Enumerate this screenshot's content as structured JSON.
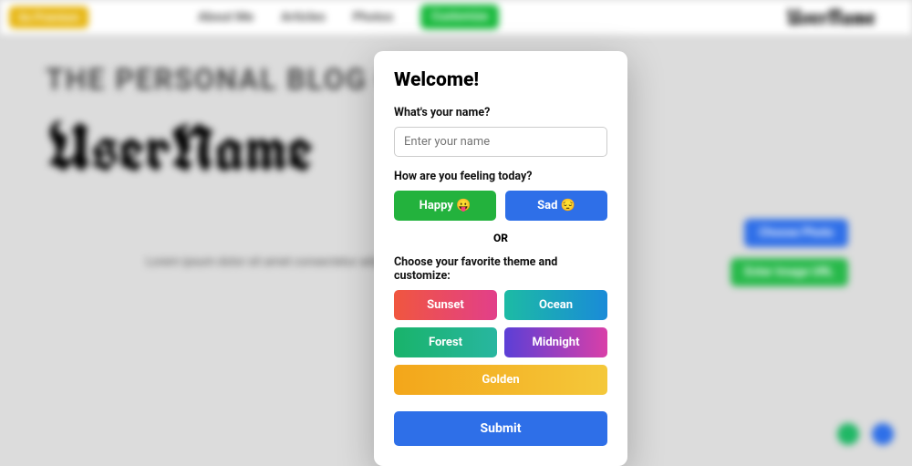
{
  "topbar": {
    "go_premium": "Go Premium",
    "nav": {
      "about": "About Me",
      "articles": "Articles",
      "photos": "Photos",
      "customize": "Customize"
    },
    "brand": "UserName"
  },
  "hero": {
    "subtitle": "THE PERSONAL BLOG OF",
    "name": "UserName",
    "lorem": "Lorem ipsum dolor sit amet consectetur adipisicing"
  },
  "side": {
    "choose_photo": "Choose Photo",
    "enter_url": "Enter Image URL"
  },
  "modal": {
    "title": "Welcome!",
    "name_label": "What's your name?",
    "name_placeholder": "Enter your name",
    "feel_label": "How are you feeling today?",
    "happy": "Happy 😛",
    "sad": "Sad 😔",
    "or": "OR",
    "theme_label": "Choose your favorite theme and customize:",
    "themes": {
      "sunset": "Sunset",
      "ocean": "Ocean",
      "forest": "Forest",
      "midnight": "Midnight",
      "golden": "Golden"
    },
    "submit": "Submit"
  },
  "colors": {
    "premium": "#e6b50e",
    "customize": "#18b93c",
    "happy": "#23b23d",
    "sad": "#2e6fe8",
    "submit": "#2e6fe8"
  }
}
